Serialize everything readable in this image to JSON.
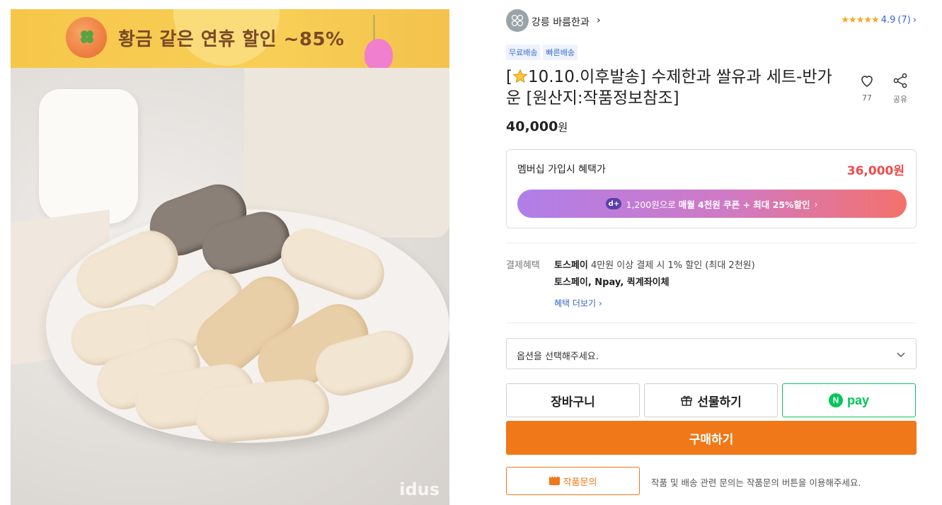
{
  "banner": {
    "text": "황금 같은 연휴 할인 ~85%"
  },
  "photo": {
    "watermark": "idus"
  },
  "shop": {
    "name": "강릉 바름한과",
    "chevron": "›"
  },
  "rating": {
    "stars": "★★★★★",
    "score": "4.9",
    "count": "(7)",
    "chevron": "›"
  },
  "tags": [
    "무료배송",
    "빠른배송"
  ],
  "product": {
    "title_prefix": "[",
    "title_rest": "10.10.이후발송] 수제한과 쌀유과 세트-반가운 [원산지:작품정보참조]",
    "price": "40,000",
    "price_unit": "원"
  },
  "actions": {
    "like_count": "77",
    "share_label": "공유"
  },
  "membership": {
    "label": "멤버십 가입시 혜택가",
    "price": "36,000원",
    "pill_badge": "d+",
    "pill_text": "1,200원으로 ",
    "pill_bold": "매월 4천원 쿠폰 + 최대 25%할인",
    "pill_chevron": "›"
  },
  "payment": {
    "label": "결제혜택",
    "line1_bold": "토스페이",
    "line1_rest": " 4만원 이상 결제 시 1% 할인 (최대 2천원)",
    "line2": "토스페이, Npay, 퀵계좌이체",
    "more": "혜택 더보기 ›"
  },
  "option": {
    "placeholder": "옵션을 선택해주세요."
  },
  "buttons": {
    "cart": "장바구니",
    "gift": "선물하기",
    "npay_n": "N",
    "npay": "pay",
    "buy": "구매하기",
    "inquiry": "작품문의"
  },
  "inquiry_note": "작품 및 배송 관련 문의는 작품문의 버튼을 이용해주세요.",
  "colors": {
    "accent": "#f07818",
    "member_price": "#ef4b4b",
    "link": "#3a63c6",
    "npay": "#03c75a",
    "star": "#f6a724"
  }
}
